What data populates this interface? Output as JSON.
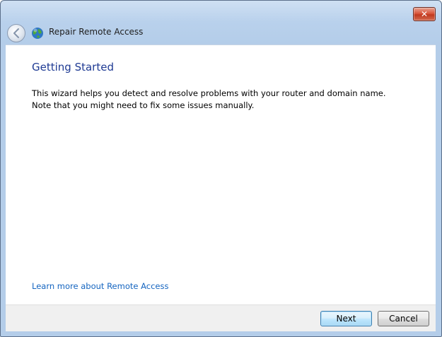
{
  "window": {
    "title": "Repair Remote Access",
    "close_label": "✕"
  },
  "icons": {
    "back": "back-arrow-icon",
    "globe": "globe-network-icon",
    "close": "close-icon"
  },
  "content": {
    "heading": "Getting Started",
    "description_lines": [
      "This wizard helps you detect and resolve problems with your router and domain name.",
      "Note that you might need to fix some issues manually."
    ],
    "learn_link": "Learn more about Remote Access"
  },
  "footer": {
    "next_label": "Next",
    "cancel_label": "Cancel"
  },
  "colors": {
    "heading": "#1e3a93",
    "link": "#1565c0",
    "titlebar": "#b9d1ec"
  }
}
